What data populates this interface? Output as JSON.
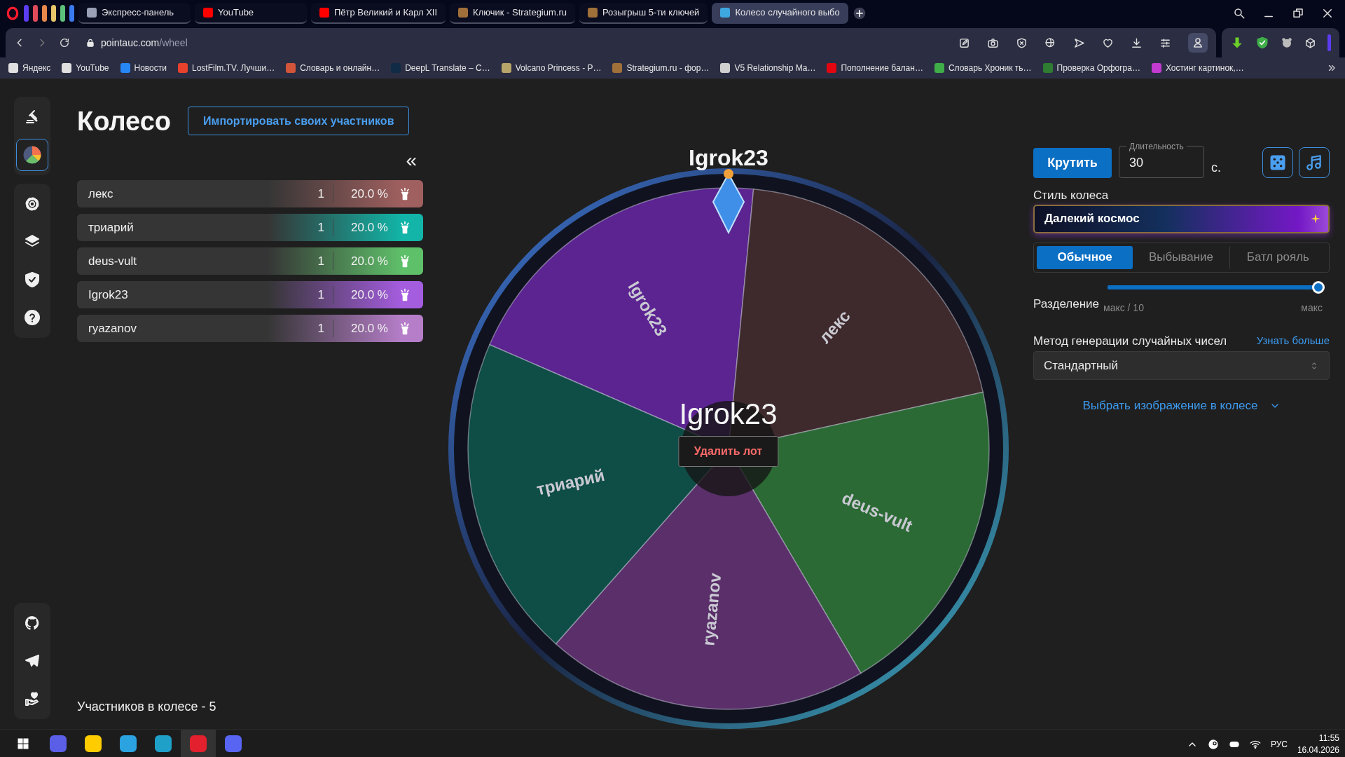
{
  "browser": {
    "tabs": [
      {
        "title": "Экспресс-панель",
        "selected": false,
        "color": "#9aa0b5"
      },
      {
        "title": "YouTube",
        "selected": false,
        "color": "#ff0000"
      },
      {
        "title": "Пётр Великий и Карл XII",
        "selected": false,
        "color": "#ff0000"
      },
      {
        "title": "Ключик - Strategium.ru",
        "selected": false,
        "color": "#a0703a"
      },
      {
        "title": "Розыгрыш 5-ти ключей",
        "selected": false,
        "color": "#a0703a"
      },
      {
        "title": "Колесо случайного выбо",
        "selected": true,
        "color": "#3fa7e0"
      }
    ],
    "address": {
      "host": "pointauc.com",
      "path": "/wheel"
    },
    "bookmarks": [
      {
        "label": "Яндекс",
        "color": "#e0e0e0"
      },
      {
        "label": "YouTube",
        "color": "#e0e0e0"
      },
      {
        "label": "Новости",
        "color": "#2787f5"
      },
      {
        "label": "LostFilm.TV. Лучши…",
        "color": "#e8412c"
      },
      {
        "label": "Словарь и онлайн…",
        "color": "#d2553a"
      },
      {
        "label": "DeepL Translate – C…",
        "color": "#0f2b46"
      },
      {
        "label": "Volcano Princess - P…",
        "color": "#b8a56a"
      },
      {
        "label": "Strategium.ru - фор…",
        "color": "#a0703a"
      },
      {
        "label": "V5 Relationship Ma…",
        "color": "#d0d0d0"
      },
      {
        "label": "Пополнение балан…",
        "color": "#e30611"
      },
      {
        "label": "Словарь Хроник ть…",
        "color": "#3fae49"
      },
      {
        "label": "Проверка Орфогра…",
        "color": "#2e7d32"
      },
      {
        "label": "Хостинг картинок,…",
        "color": "#c23ad0"
      }
    ]
  },
  "sidebar": {
    "groups": [
      {
        "items": [
          {
            "kind": "gavel",
            "selected": false
          },
          {
            "kind": "pie",
            "selected": true
          }
        ]
      },
      {
        "items": [
          {
            "kind": "gear",
            "selected": false
          },
          {
            "kind": "layers",
            "selected": false
          },
          {
            "kind": "shield",
            "selected": false
          },
          {
            "kind": "help",
            "selected": false
          }
        ]
      },
      {
        "items": [
          {
            "kind": "github",
            "selected": false
          },
          {
            "kind": "telegram",
            "selected": false
          },
          {
            "kind": "donate",
            "selected": false
          }
        ]
      }
    ]
  },
  "page": {
    "title": "Колесо",
    "import_button": "Импортировать своих участников",
    "collapse": "«"
  },
  "participants": [
    {
      "name": "лекс",
      "amount": "1",
      "percent": "20.0 %",
      "color": "#a0605f"
    },
    {
      "name": "триарий",
      "amount": "1",
      "percent": "20.0 %",
      "color": "#12b5a8"
    },
    {
      "name": "deus-vult",
      "amount": "1",
      "percent": "20.0 %",
      "color": "#5fc06a"
    },
    {
      "name": "Igrok23",
      "amount": "1",
      "percent": "20.0 %",
      "color": "#a55de0"
    },
    {
      "name": "ryazanov",
      "amount": "1",
      "percent": "20.0 %",
      "color": "#b67ec9"
    }
  ],
  "participants_count": "Участников в колесе - 5",
  "wheel": {
    "winner_top": "Igrok23",
    "winner_center": "Igrok23",
    "delete_button": "Удалить лот",
    "segments": [
      {
        "label": "Igrok23",
        "color": "#5b2491"
      },
      {
        "label": "лекс",
        "color": "#3e2a2d"
      },
      {
        "label": "deus-vult",
        "color": "#2b6a35"
      },
      {
        "label": "ryazanov",
        "color": "#5a2f6a"
      },
      {
        "label": "триарий",
        "color": "#0f4d47"
      }
    ]
  },
  "controls": {
    "spin_button": "Крутить",
    "duration": {
      "label": "Длительность",
      "value": "30"
    },
    "duration_unit": "с.",
    "style_label": "Стиль колеса",
    "style_value": "Далекий космос",
    "modes": [
      {
        "label": "Обычное",
        "selected": true
      },
      {
        "label": "Выбывание",
        "selected": false
      },
      {
        "label": "Батл рояль",
        "selected": false
      }
    ],
    "split": {
      "label": "Разделение",
      "level": 1,
      "min_label": "макс / 10",
      "max_label": "макс"
    },
    "rng": {
      "label": "Метод генерации случайных чисел",
      "link": "Узнать больше",
      "value": "Стандартный"
    },
    "image_picker": "Выбрать изображение в колесе"
  },
  "taskbar": {
    "apps": [
      {
        "color": "#5b5fe8",
        "selected": false
      },
      {
        "color": "#ffcc00",
        "selected": false
      },
      {
        "color": "#2aa3e0",
        "selected": false
      },
      {
        "color": "#1fa0c8",
        "selected": false
      },
      {
        "color": "#e3202d",
        "selected": true
      },
      {
        "color": "#5865f2",
        "selected": false
      }
    ],
    "language": "РУС",
    "time": "11:55",
    "date": "16.04.2026"
  }
}
